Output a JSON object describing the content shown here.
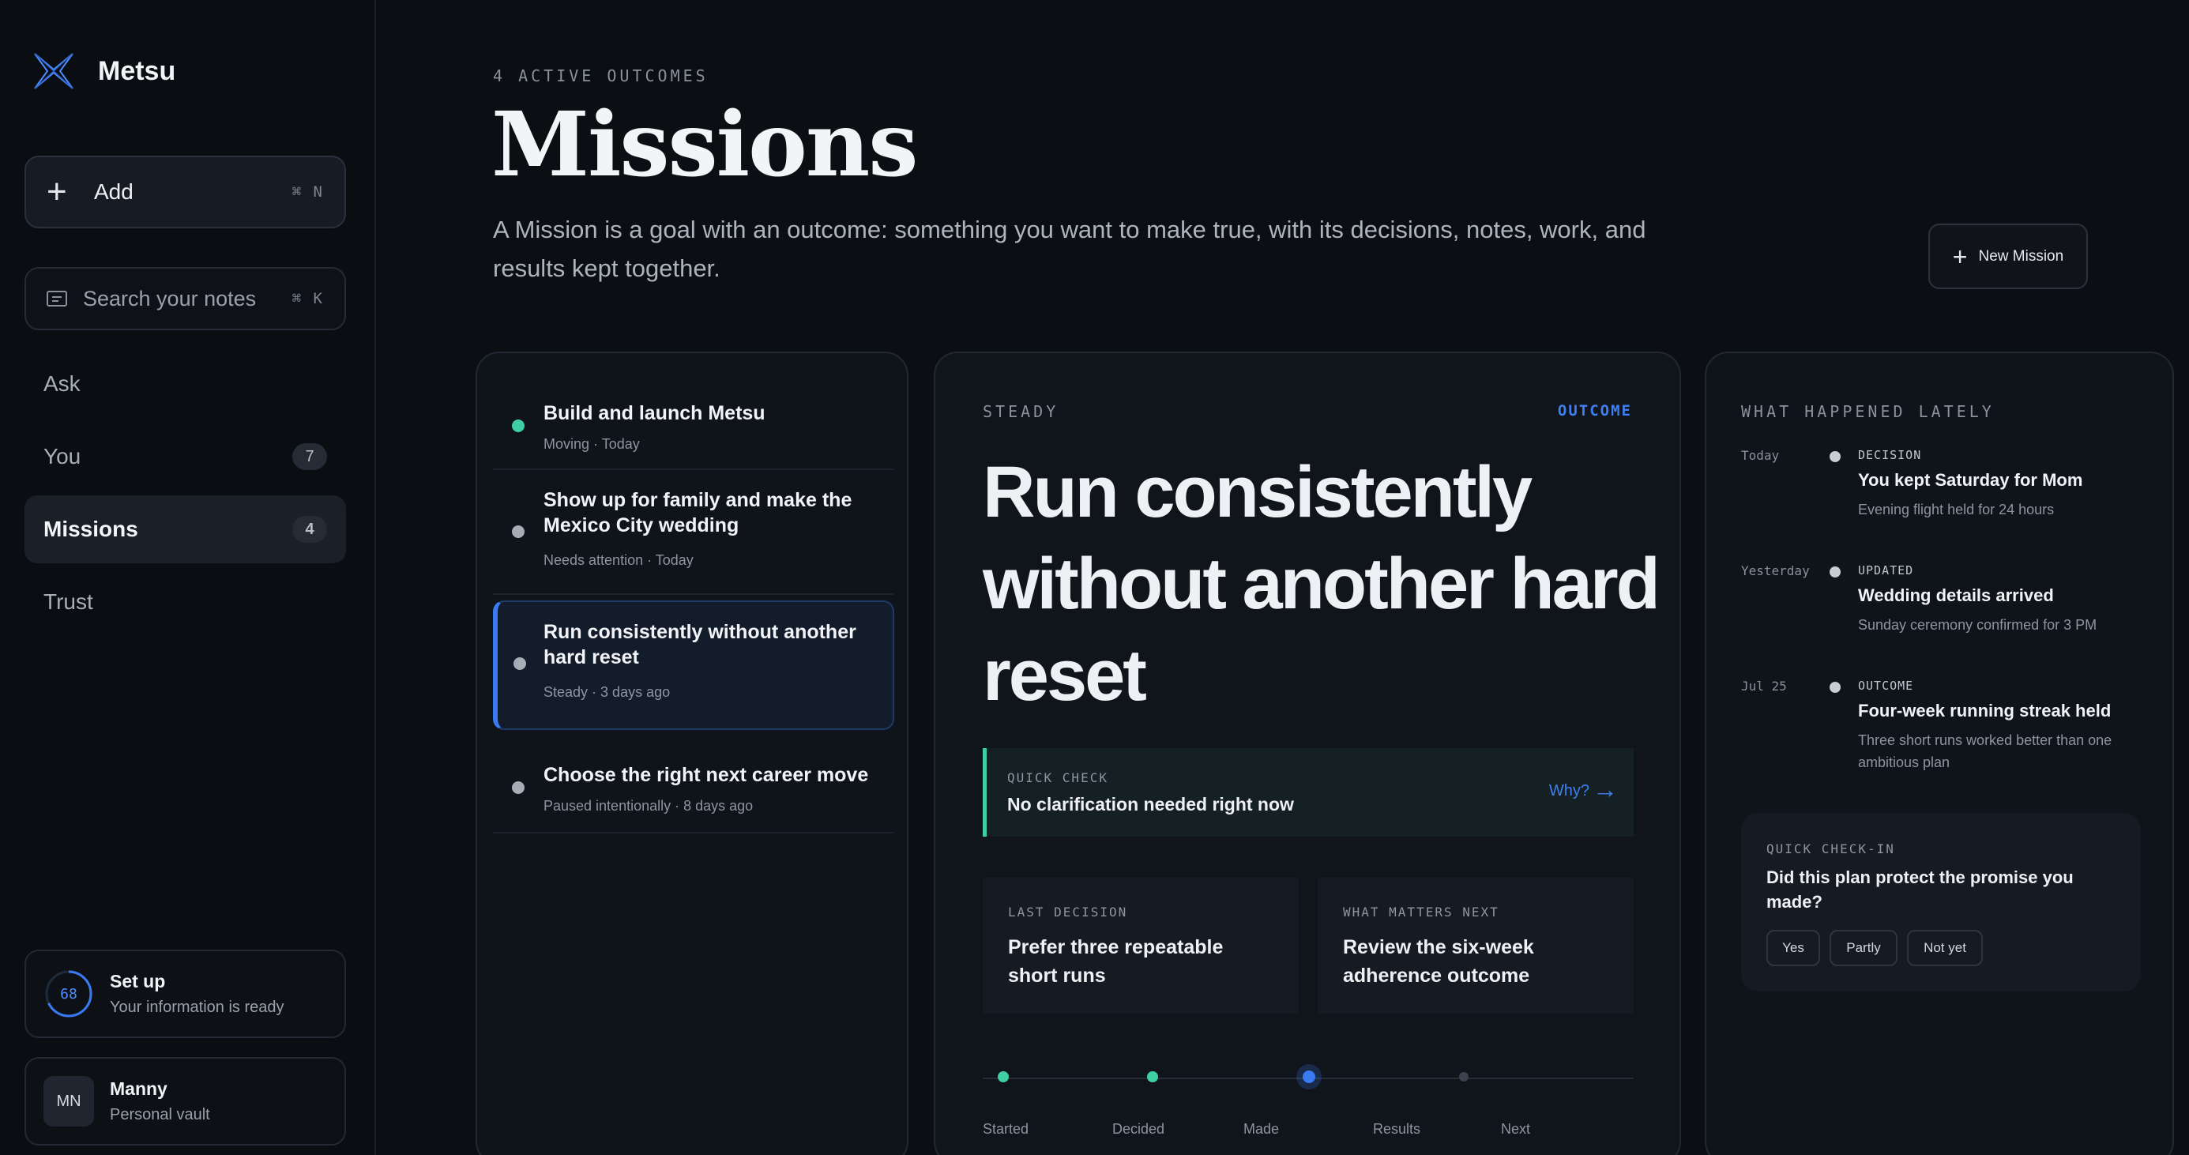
{
  "brand": {
    "name": "Metsu"
  },
  "sidebar": {
    "add": {
      "label": "Add",
      "shortcut": "⌘ N"
    },
    "search": {
      "placeholder": "Search your notes",
      "shortcut": "⌘ K"
    },
    "nav": [
      {
        "label": "Ask",
        "count": ""
      },
      {
        "label": "You",
        "count": "7"
      },
      {
        "label": "Missions",
        "count": "4"
      },
      {
        "label": "Trust",
        "count": ""
      }
    ],
    "setup": {
      "progress": "68",
      "title": "Set up",
      "subtitle": "Your information is ready"
    },
    "user": {
      "initials": "MN",
      "name": "Manny",
      "subtitle": "Personal vault"
    }
  },
  "header": {
    "eyebrow": "4 ACTIVE OUTCOMES",
    "title": "Missions",
    "description": "A Mission is a goal with an outcome: something you want to make true, with its decisions, notes, work, and results kept together.",
    "new_mission": "New Mission"
  },
  "missions": [
    {
      "title": "Build and launch Metsu",
      "status": "Moving",
      "when": "Today",
      "dot": "#3fcfa2"
    },
    {
      "title": "Show up for family and make the Mexico City wedding",
      "status": "Needs attention",
      "when": "Today",
      "dot": "#a7adb6"
    },
    {
      "title": "Run consistently without another hard reset",
      "status": "Steady",
      "when": "3 days ago",
      "dot": "#a7adb6"
    },
    {
      "title": "Choose the right next career move",
      "status": "Paused intentionally",
      "when": "8 days ago",
      "dot": "#a7adb6"
    }
  ],
  "detail": {
    "state": "STEADY",
    "tag": "OUTCOME",
    "title": "Run consistently without another hard reset",
    "quick_check": {
      "label": "QUICK CHECK",
      "value": "No clarification needed right now",
      "why": "Why?"
    },
    "last_decision": {
      "label": "LAST DECISION",
      "value": "Prefer three repeatable short runs"
    },
    "next": {
      "label": "WHAT MATTERS NEXT",
      "value": "Review the six-week adherence outcome"
    },
    "stages": [
      "Started",
      "Decided",
      "Made",
      "Results",
      "Next"
    ],
    "current_stage": "Made"
  },
  "lately": {
    "title": "WHAT HAPPENED LATELY",
    "events": [
      {
        "day": "Today",
        "kind": "DECISION",
        "title": "You kept Saturday for Mom",
        "sub": "Evening flight held for 24 hours"
      },
      {
        "day": "Yesterday",
        "kind": "UPDATED",
        "title": "Wedding details arrived",
        "sub": "Sunday ceremony confirmed for 3 PM"
      },
      {
        "day": "Jul 25",
        "kind": "OUTCOME",
        "title": "Four-week running streak held",
        "sub": "Three short runs worked better than one ambitious plan"
      }
    ],
    "checkin": {
      "label": "QUICK CHECK-IN",
      "question": "Did this plan protect the promise you made?",
      "options": [
        "Yes",
        "Partly",
        "Not yet"
      ]
    }
  },
  "colors": {
    "accent": "#3b7bf2",
    "success": "#3fcfa2",
    "background": "#0b0e13"
  }
}
